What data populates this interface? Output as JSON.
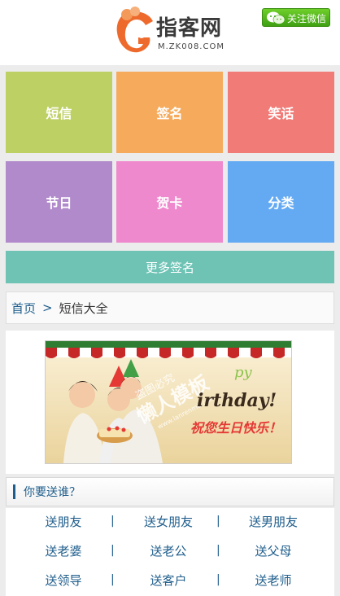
{
  "header": {
    "logo_text": "指客网",
    "logo_sub": "M.ZK008.COM",
    "wechat_label": "关注微信"
  },
  "tiles": [
    {
      "label": "短信",
      "color": "#bdd063"
    },
    {
      "label": "签名",
      "color": "#f6ab5c"
    },
    {
      "label": "笑话",
      "color": "#f07b77"
    },
    {
      "label": "节日",
      "color": "#b18acb"
    },
    {
      "label": "贺卡",
      "color": "#ef89cd"
    },
    {
      "label": "分类",
      "color": "#63aaf3"
    }
  ],
  "more_button": "更多签名",
  "breadcrumb": {
    "home": "首页",
    "separator": ">",
    "current": "短信大全"
  },
  "banner": {
    "watermark_top": "盗图必究",
    "watermark_main": "懒人模板",
    "watermark_url": "www.lanrenmb.com",
    "birthday_text": "irthday!",
    "happy_text": "py",
    "wish_text": "祝您生日快乐！"
  },
  "section": {
    "title": "你要送谁？"
  },
  "links": [
    [
      "送朋友",
      "送女朋友",
      "送男朋友"
    ],
    [
      "送老婆",
      "送老公",
      "送父母"
    ],
    [
      "送领导",
      "送客户",
      "送老师"
    ]
  ],
  "link_separator": "|"
}
